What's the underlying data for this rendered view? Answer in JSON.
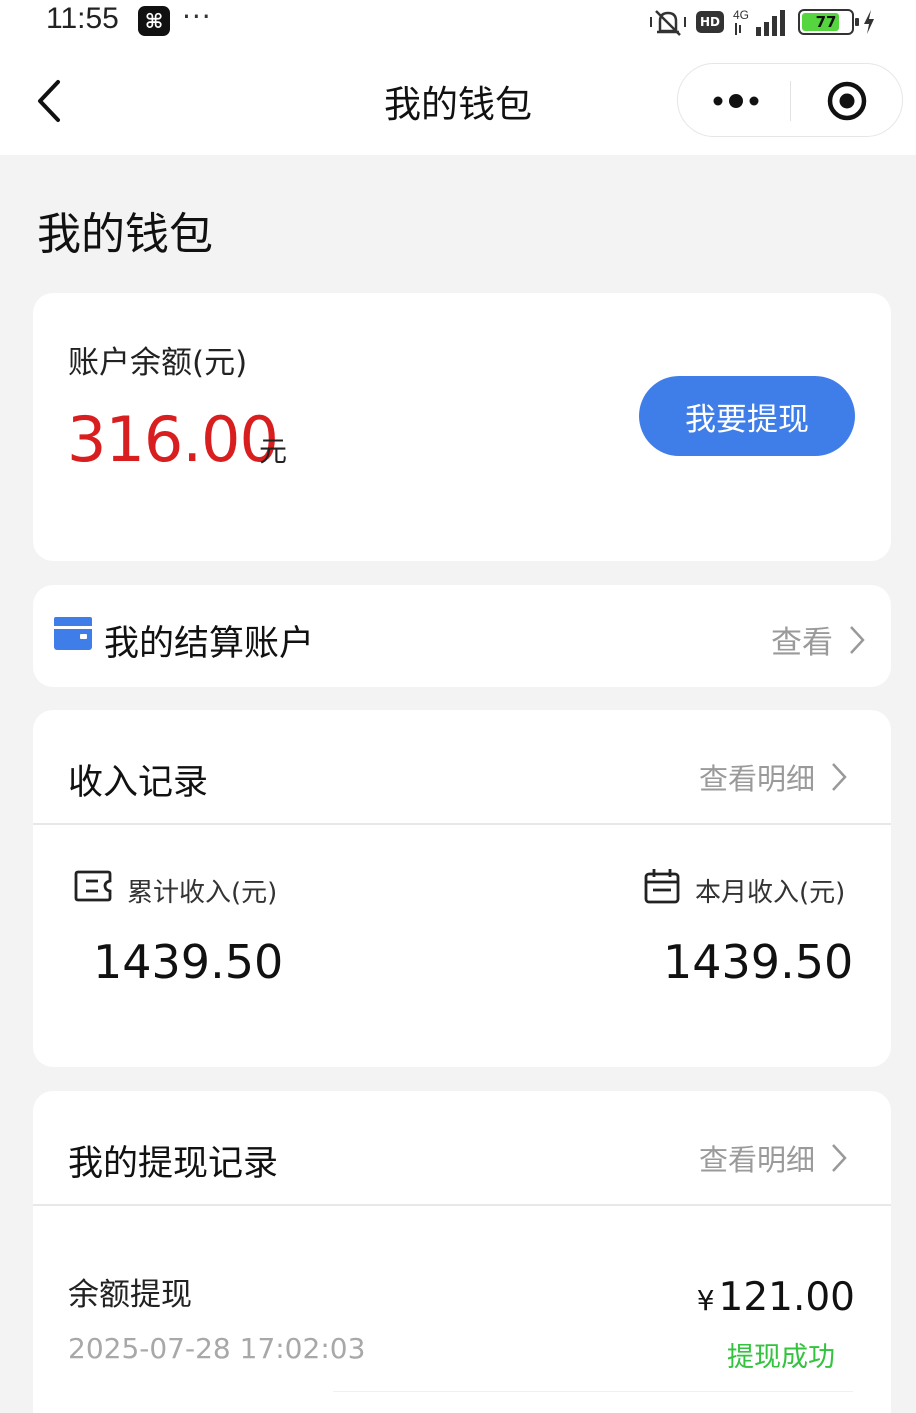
{
  "status_bar": {
    "time": "11:55",
    "network": "4G",
    "hd_label": "HD",
    "battery": "77"
  },
  "nav": {
    "title": "我的钱包"
  },
  "page_title": "我的钱包",
  "balance": {
    "label": "账户余额(元)",
    "value": "316.00",
    "unit": "元",
    "withdraw_button": "我要提现"
  },
  "settlement": {
    "label": "我的结算账户",
    "link": "查看"
  },
  "income": {
    "title": "收入记录",
    "link": "查看明细",
    "total_label": "累计收入(元)",
    "total_value": "1439.50",
    "month_label": "本月收入(元)",
    "month_value": "1439.50"
  },
  "withdrawals": {
    "title": "我的提现记录",
    "link": "查看明细",
    "items": [
      {
        "title": "余额提现",
        "time": "2025-07-28 17:02:03",
        "currency": "¥",
        "amount": "121.00",
        "status": "提现成功"
      }
    ]
  },
  "colors": {
    "accent_blue": "#3f7de8",
    "balance_red": "#d81e1e",
    "success_green": "#33c33f",
    "page_bg": "#f3f3f3"
  }
}
